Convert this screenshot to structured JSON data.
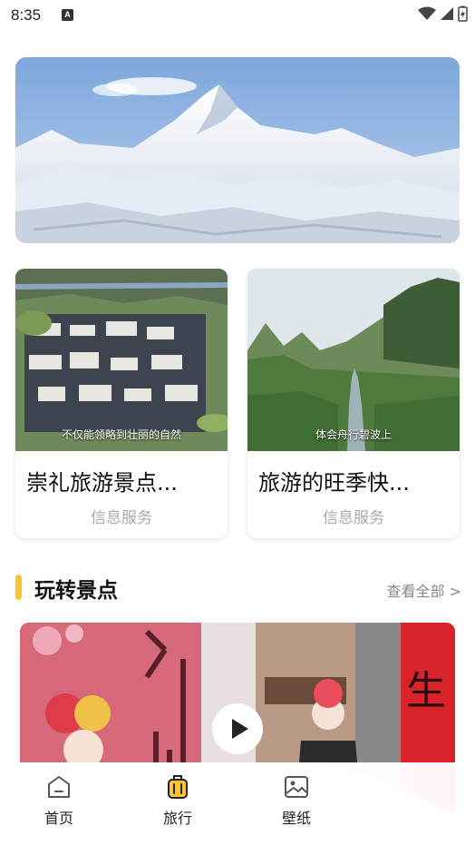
{
  "status_bar": {
    "time": "8:35",
    "notification_glyph": "A",
    "icons": [
      "wifi-icon",
      "signal-icon",
      "battery-charging-icon"
    ]
  },
  "hero": {
    "image": "snow-mountain-panorama"
  },
  "cards": [
    {
      "image": "town-aerial-view",
      "caption": "不仅能领略到壮丽的自然",
      "title": "崇礼旅游景点...",
      "subtitle": "信息服务"
    },
    {
      "image": "karst-river-landscape",
      "caption": "体会舟行碧波上",
      "title": "旅游的旺季快...",
      "subtitle": "信息服务"
    }
  ],
  "section": {
    "title": "玩转景点",
    "view_all": "查看全部 >"
  },
  "video": {
    "image": "costumed-woman-red-wall",
    "banner_text": "生"
  },
  "tabbar": {
    "items": [
      {
        "label": "首页",
        "icon": "home-icon",
        "active": false
      },
      {
        "label": "旅行",
        "icon": "luggage-icon",
        "active": true
      },
      {
        "label": "壁纸",
        "icon": "image-icon",
        "active": false
      }
    ]
  },
  "colors": {
    "accent": "#ffc62a",
    "muted_text": "#aaaaaa",
    "view_all": "#888888"
  }
}
